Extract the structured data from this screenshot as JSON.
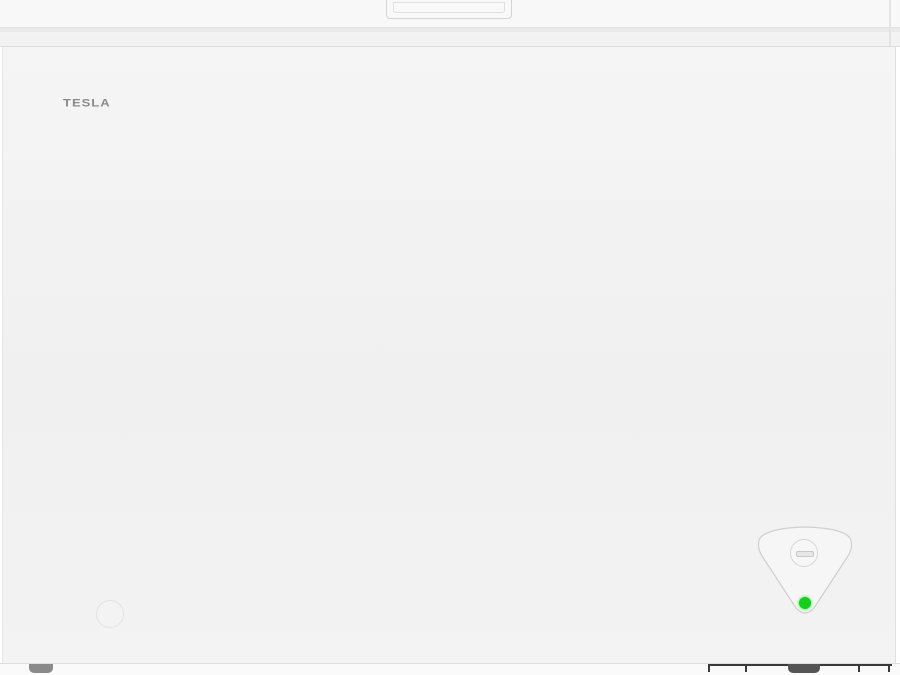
{
  "product": {
    "brand_label": "TESLA",
    "appliance": "chest-freezer",
    "panel_color": "#f2f2f2",
    "indicator_color": "#11d11a"
  },
  "controls": {
    "thermostat_icon": "thermostat-dial-icon",
    "power_indicator_icon": "power-led-icon"
  }
}
